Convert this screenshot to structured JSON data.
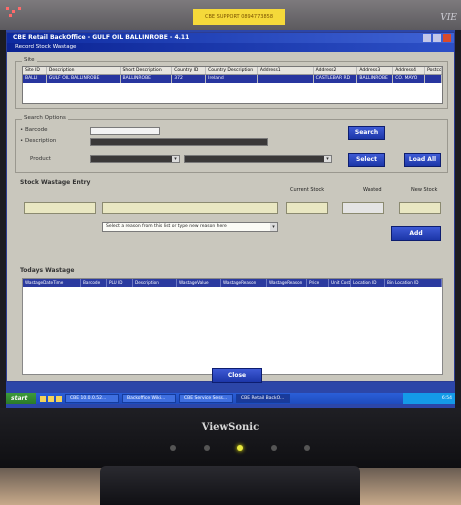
{
  "photo": {
    "label_sticker": "CBE SUPPORT 0894773858",
    "monitor_brand_corner": "VIE",
    "bezel_brand": "ViewSonic"
  },
  "app": {
    "title": "CBE Retail BackOffice - GULF OIL BALLINROBE - 4.11",
    "window_title": "Record Stock Wastage"
  },
  "site": {
    "legend": "Site",
    "headers": [
      "Site ID",
      "Description",
      "Short Description",
      "Country ID",
      "Country Description",
      "Address1",
      "Address2",
      "Address3",
      "Address4",
      "Postco"
    ],
    "row": [
      "BALLI",
      "GULF OIL BALLINROBE",
      "BALLINROBE",
      "372",
      "Ireland",
      "",
      "CASTLEBAR RD",
      "BALLINROBE",
      "CO. MAYO",
      ""
    ]
  },
  "search": {
    "legend": "Search Options",
    "barcode_label": "Barcode",
    "description_label": "Description",
    "product_label": "Product",
    "barcode_value": "",
    "description_value": "",
    "product_value_1": "",
    "product_value_2": "",
    "search_button": "Search",
    "select_button": "Select",
    "load_all_button": "Load All"
  },
  "entry": {
    "legend": "Stock Wastage Entry",
    "current_stock_label": "Current Stock",
    "wasted_label": "Wasted",
    "new_stock_label": "New Stock",
    "reason_placeholder": "Select a reason from this list or type new reason here",
    "add_button": "Add"
  },
  "todays": {
    "legend": "Todays Wastage",
    "headers": [
      "WastageDateTime",
      "Barcode",
      "PLU ID",
      "Description",
      "WastageValue",
      "WastageReason",
      "WastageReason",
      "Price",
      "Unit Cost",
      "Location ID",
      "Bin Location ID"
    ]
  },
  "close_button": "Close",
  "taskbar": {
    "start": "start",
    "tasks": [
      "CBE 10.0.0.52...",
      "Backoffice Wiki...",
      "CBE Service Sess...",
      "CBE Retail BackO..."
    ],
    "tray_text": "6:54"
  },
  "colors": {
    "window_face": "#c9c7bd",
    "title_blue": "#0d2aa0",
    "button_blue": "#1c36a8",
    "selection_blue": "#27359f",
    "entry_field": "#e9e7c2"
  }
}
